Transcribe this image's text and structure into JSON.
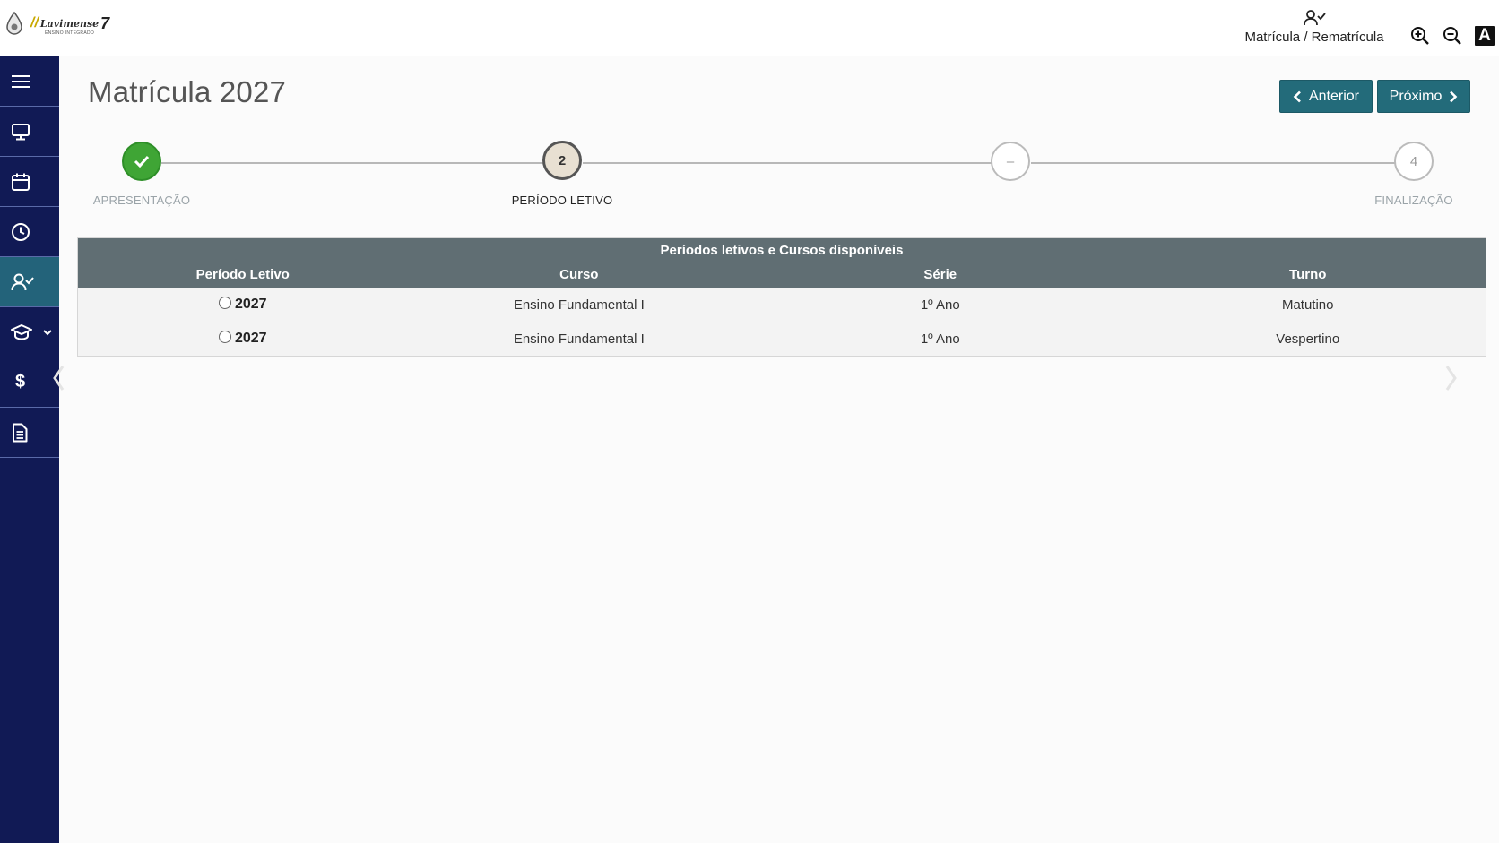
{
  "header": {
    "logo_text": "Lavimense",
    "logo_subtitle": "ENSINO INTEGRADO",
    "module_label": "Matrícula / Rematrícula",
    "module_icon": "user-check-icon",
    "tools": [
      "zoom-in-icon",
      "zoom-out-icon",
      "font-size-icon"
    ],
    "font_tool_label": "A"
  },
  "sidebar": {
    "items": [
      {
        "icon": "menu-icon",
        "active": false
      },
      {
        "icon": "monitor-icon",
        "active": false
      },
      {
        "icon": "calendar-icon",
        "active": false
      },
      {
        "icon": "clock-icon",
        "active": false
      },
      {
        "icon": "user-check-icon",
        "active": true
      },
      {
        "icon": "graduation-cap-icon",
        "active": false,
        "has_dropdown": true
      },
      {
        "icon": "dollar-icon",
        "active": false,
        "glyph": "$"
      },
      {
        "icon": "document-icon",
        "active": false
      }
    ]
  },
  "main": {
    "title": "Matrícula 2027",
    "prev_button": "Anterior",
    "next_button": "Próximo"
  },
  "stepper": {
    "steps": [
      {
        "number": "",
        "label": "APRESENTAÇÃO",
        "state": "done"
      },
      {
        "number": "2",
        "label": "PERÍODO LETIVO",
        "state": "current"
      },
      {
        "number": "–",
        "label": "",
        "state": "pending"
      },
      {
        "number": "4",
        "label": "FINALIZAÇÃO",
        "state": "pending"
      }
    ]
  },
  "table": {
    "caption": "Períodos letivos e Cursos disponíveis",
    "headers": [
      "Período Letivo",
      "Curso",
      "Série",
      "Turno"
    ],
    "rows": [
      {
        "periodo": "2027",
        "curso": "Ensino Fundamental I",
        "serie": "1º Ano",
        "turno": "Matutino"
      },
      {
        "periodo": "2027",
        "curso": "Ensino Fundamental I",
        "serie": "1º Ano",
        "turno": "Vespertino"
      }
    ]
  },
  "colors": {
    "sidebar_bg": "#111a55",
    "sidebar_active": "#23637a",
    "button_bg": "#236b7a",
    "step_done": "#3fa535",
    "table_header": "#606e73"
  }
}
